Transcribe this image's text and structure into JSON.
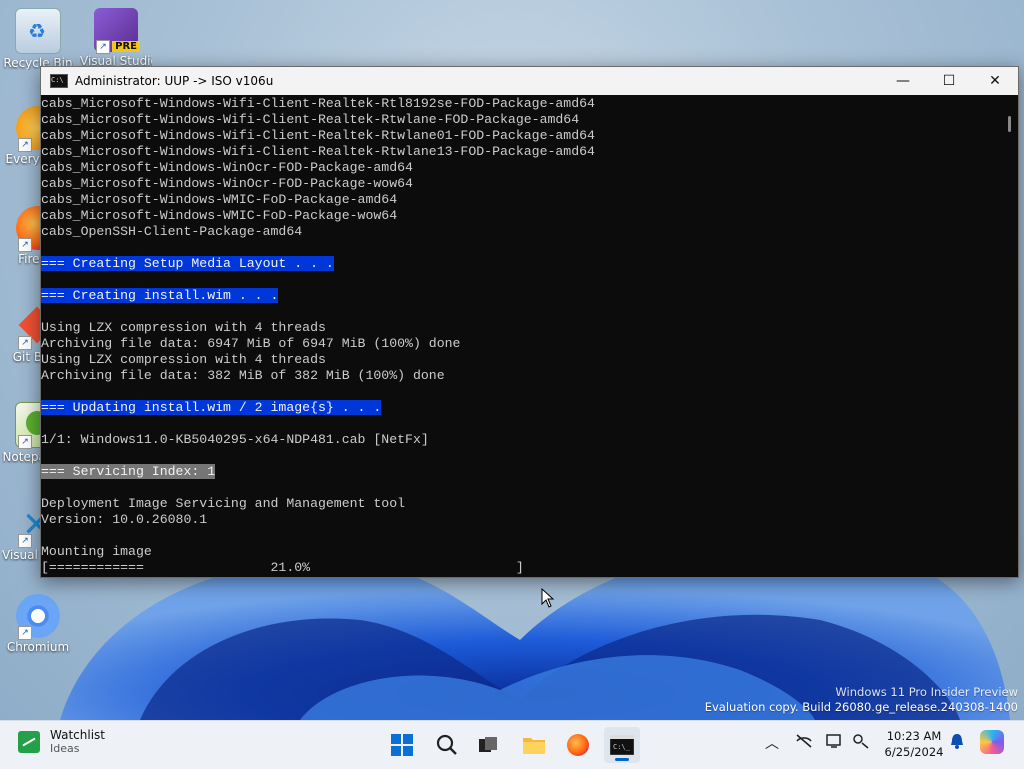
{
  "desktop": {
    "icons": [
      {
        "label": "Recycle Bin",
        "icon": "recycle-bin-icon"
      },
      {
        "label": "Visual Studio",
        "icon": "visual-studio-icon",
        "badge": "PRE"
      },
      {
        "label": "Everything",
        "icon": "everything-icon"
      },
      {
        "label": "Firefox",
        "icon": "firefox-icon"
      },
      {
        "label": "Git Bash",
        "icon": "git-icon"
      },
      {
        "label": "Notepad++",
        "icon": "notepadpp-icon"
      },
      {
        "label": "Visual Studio Code",
        "icon": "vscode-icon"
      },
      {
        "label": "Chromium",
        "icon": "chromium-icon"
      }
    ],
    "watermark": {
      "line1": "Windows 11 Pro Insider Preview",
      "line2": "Evaluation copy. Build 26080.ge_release.240308-1400"
    }
  },
  "window": {
    "title": "Administrator:  UUP -> ISO v106u",
    "minimize": "—",
    "maximize": "☐",
    "close": "✕"
  },
  "console": {
    "lines": [
      {
        "text": "cabs_Microsoft-Windows-Wifi-Client-Realtek-Rtl8192se-FOD-Package-amd64",
        "style": ""
      },
      {
        "text": "cabs_Microsoft-Windows-Wifi-Client-Realtek-Rtwlane-FOD-Package-amd64",
        "style": ""
      },
      {
        "text": "cabs_Microsoft-Windows-Wifi-Client-Realtek-Rtwlane01-FOD-Package-amd64",
        "style": ""
      },
      {
        "text": "cabs_Microsoft-Windows-Wifi-Client-Realtek-Rtwlane13-FOD-Package-amd64",
        "style": ""
      },
      {
        "text": "cabs_Microsoft-Windows-WinOcr-FOD-Package-amd64",
        "style": ""
      },
      {
        "text": "cabs_Microsoft-Windows-WinOcr-FOD-Package-wow64",
        "style": ""
      },
      {
        "text": "cabs_Microsoft-Windows-WMIC-FoD-Package-amd64",
        "style": ""
      },
      {
        "text": "cabs_Microsoft-Windows-WMIC-FoD-Package-wow64",
        "style": ""
      },
      {
        "text": "cabs_OpenSSH-Client-Package-amd64",
        "style": ""
      },
      {
        "text": "",
        "style": ""
      },
      {
        "text": "=== Creating Setup Media Layout . . .",
        "style": "blue"
      },
      {
        "text": "",
        "style": ""
      },
      {
        "text": "=== Creating install.wim . . .",
        "style": "blue"
      },
      {
        "text": "",
        "style": ""
      },
      {
        "text": "Using LZX compression with 4 threads",
        "style": ""
      },
      {
        "text": "Archiving file data: 6947 MiB of 6947 MiB (100%) done",
        "style": ""
      },
      {
        "text": "Using LZX compression with 4 threads",
        "style": ""
      },
      {
        "text": "Archiving file data: 382 MiB of 382 MiB (100%) done",
        "style": ""
      },
      {
        "text": "",
        "style": ""
      },
      {
        "text": "=== Updating install.wim / 2 image{s} . . .",
        "style": "blue"
      },
      {
        "text": "",
        "style": ""
      },
      {
        "text": "1/1: Windows11.0-KB5040295-x64-NDP481.cab [NetFx]",
        "style": ""
      },
      {
        "text": "",
        "style": ""
      },
      {
        "text": "=== Servicing Index: 1",
        "style": "gray"
      },
      {
        "text": "",
        "style": ""
      },
      {
        "text": "Deployment Image Servicing and Management tool",
        "style": ""
      },
      {
        "text": "Version: 10.0.26080.1",
        "style": ""
      },
      {
        "text": "",
        "style": ""
      },
      {
        "text": "Mounting image",
        "style": ""
      },
      {
        "text": "[============                21.0%                          ]",
        "style": ""
      }
    ],
    "progress_percent": 21.0
  },
  "taskbar": {
    "widget": {
      "title": "Watchlist",
      "subtitle": "Ideas"
    },
    "apps": [
      {
        "name": "start",
        "icon": "windows-start-icon"
      },
      {
        "name": "search",
        "icon": "search-icon"
      },
      {
        "name": "task-view",
        "icon": "task-view-icon"
      },
      {
        "name": "file-explorer",
        "icon": "folder-icon"
      },
      {
        "name": "firefox",
        "icon": "firefox-icon"
      },
      {
        "name": "terminal",
        "icon": "terminal-icon",
        "active": true
      }
    ],
    "tray": [
      "chevron-up-icon",
      "network-off-icon",
      "display-icon",
      "accessibility-icon"
    ],
    "clock": {
      "time": "10:23 AM",
      "date": "6/25/2024"
    }
  },
  "colors": {
    "console_bg": "#0c0c0c",
    "console_fg": "#cccccc",
    "highlight_blue": "#0037da",
    "highlight_gray": "#767676",
    "taskbar_bg": "#eef2f6"
  }
}
